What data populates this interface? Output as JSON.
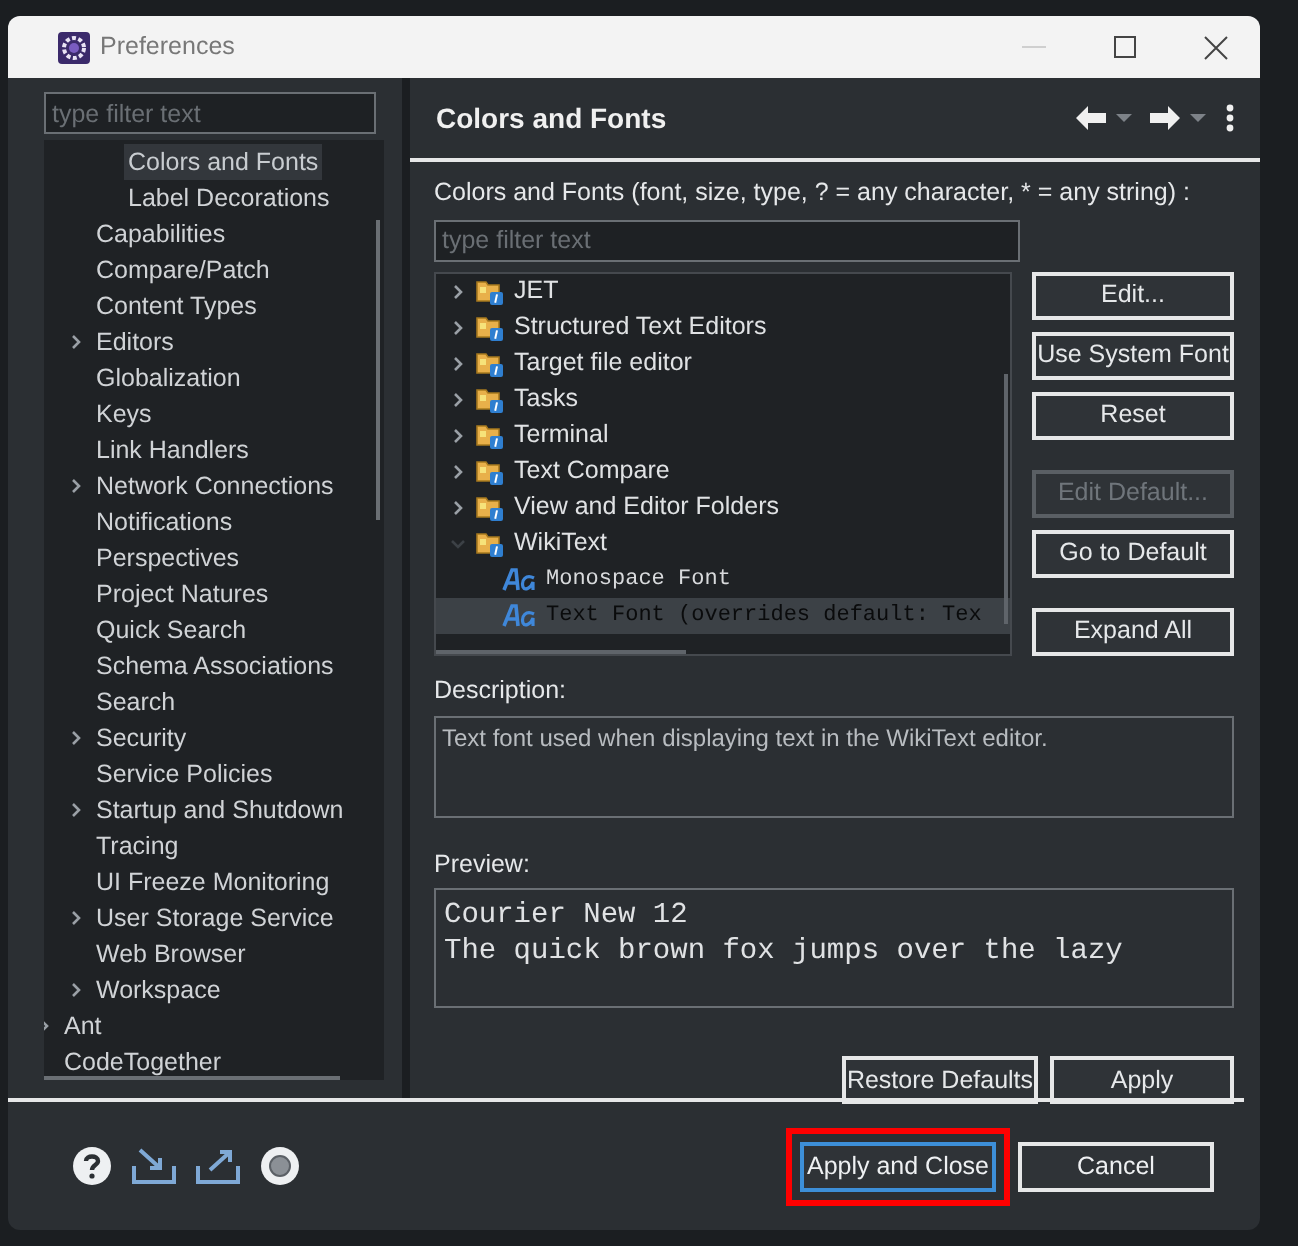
{
  "window": {
    "title": "Preferences"
  },
  "sidebar": {
    "filter_placeholder": "type filter text",
    "tree": [
      {
        "children": [
          {
            "children": [
              {
                "label": "Colors and Fonts",
                "selected": true,
                "expandable": false
              },
              {
                "label": "Label Decorations",
                "selected": false,
                "expandable": false
              }
            ]
          },
          {
            "label": "Capabilities",
            "selected": false,
            "expandable": false
          },
          {
            "label": "Compare/Patch",
            "selected": false,
            "expandable": false
          },
          {
            "label": "Content Types",
            "selected": false,
            "expandable": false
          },
          {
            "label": "Editors",
            "selected": false,
            "expandable": true
          },
          {
            "label": "Globalization",
            "selected": false,
            "expandable": false
          },
          {
            "label": "Keys",
            "selected": false,
            "expandable": false
          },
          {
            "label": "Link Handlers",
            "selected": false,
            "expandable": false
          },
          {
            "label": "Network Connections",
            "selected": false,
            "expandable": true
          },
          {
            "label": "Notifications",
            "selected": false,
            "expandable": false
          },
          {
            "label": "Perspectives",
            "selected": false,
            "expandable": false
          },
          {
            "label": "Project Natures",
            "selected": false,
            "expandable": false
          },
          {
            "label": "Quick Search",
            "selected": false,
            "expandable": false
          },
          {
            "label": "Schema Associations",
            "selected": false,
            "expandable": false
          },
          {
            "label": "Search",
            "selected": false,
            "expandable": false
          },
          {
            "label": "Security",
            "selected": false,
            "expandable": true
          },
          {
            "label": "Service Policies",
            "selected": false,
            "expandable": false
          },
          {
            "label": "Startup and Shutdown",
            "selected": false,
            "expandable": true
          },
          {
            "label": "Tracing",
            "selected": false,
            "expandable": false
          },
          {
            "label": "UI Freeze Monitoring",
            "selected": false,
            "expandable": false
          },
          {
            "label": "User Storage Service",
            "selected": false,
            "expandable": true
          },
          {
            "label": "Web Browser",
            "selected": false,
            "expandable": false
          },
          {
            "label": "Workspace",
            "selected": false,
            "expandable": true
          }
        ]
      },
      {
        "label": "Ant",
        "selected": false,
        "expandable": true
      },
      {
        "label": "CodeTogether",
        "selected": false,
        "expandable": false
      }
    ]
  },
  "page": {
    "title": "Colors and Fonts",
    "intro": "Colors and Fonts (font, size, type, ? = any character, * = any string) :",
    "filter_placeholder": "type filter text",
    "tree": [
      {
        "kind": "category",
        "label": "JET",
        "expanded": false,
        "selected": false
      },
      {
        "kind": "category",
        "label": "Structured Text Editors",
        "expanded": false,
        "selected": false
      },
      {
        "kind": "category",
        "label": "Target file editor",
        "expanded": false,
        "selected": false
      },
      {
        "kind": "category",
        "label": "Tasks",
        "expanded": false,
        "selected": false
      },
      {
        "kind": "category",
        "label": "Terminal",
        "expanded": false,
        "selected": false
      },
      {
        "kind": "category",
        "label": "Text Compare",
        "expanded": false,
        "selected": false
      },
      {
        "kind": "category",
        "label": "View and Editor Folders",
        "expanded": false,
        "selected": false
      },
      {
        "kind": "category",
        "label": "WikiText",
        "expanded": true,
        "selected": false,
        "children": [
          {
            "kind": "font",
            "label": "Monospace Font",
            "selected": false
          },
          {
            "kind": "font",
            "label": "Text Font (overrides default: Tex",
            "selected": true
          }
        ]
      }
    ],
    "side_buttons": [
      {
        "label": "Edit...",
        "disabled": false
      },
      {
        "label": "Use System Font",
        "disabled": false
      },
      {
        "label": "Reset",
        "disabled": false
      },
      {
        "label": "Edit Default...",
        "disabled": true
      },
      {
        "label": "Go to Default",
        "disabled": false
      },
      {
        "label": "Expand All",
        "disabled": false
      }
    ],
    "description_label": "Description:",
    "description": "Text font used when displaying text in the WikiText editor.",
    "preview_label": "Preview:",
    "preview_lines": [
      "Courier New 12",
      "The quick brown fox jumps over the lazy"
    ],
    "buttons": [
      "Restore Defaults",
      "Apply"
    ]
  },
  "footer": {
    "buttons": [
      {
        "label": "Apply and Close",
        "default": true,
        "highlighted": true
      },
      {
        "label": "Cancel",
        "default": false,
        "highlighted": false
      }
    ]
  }
}
